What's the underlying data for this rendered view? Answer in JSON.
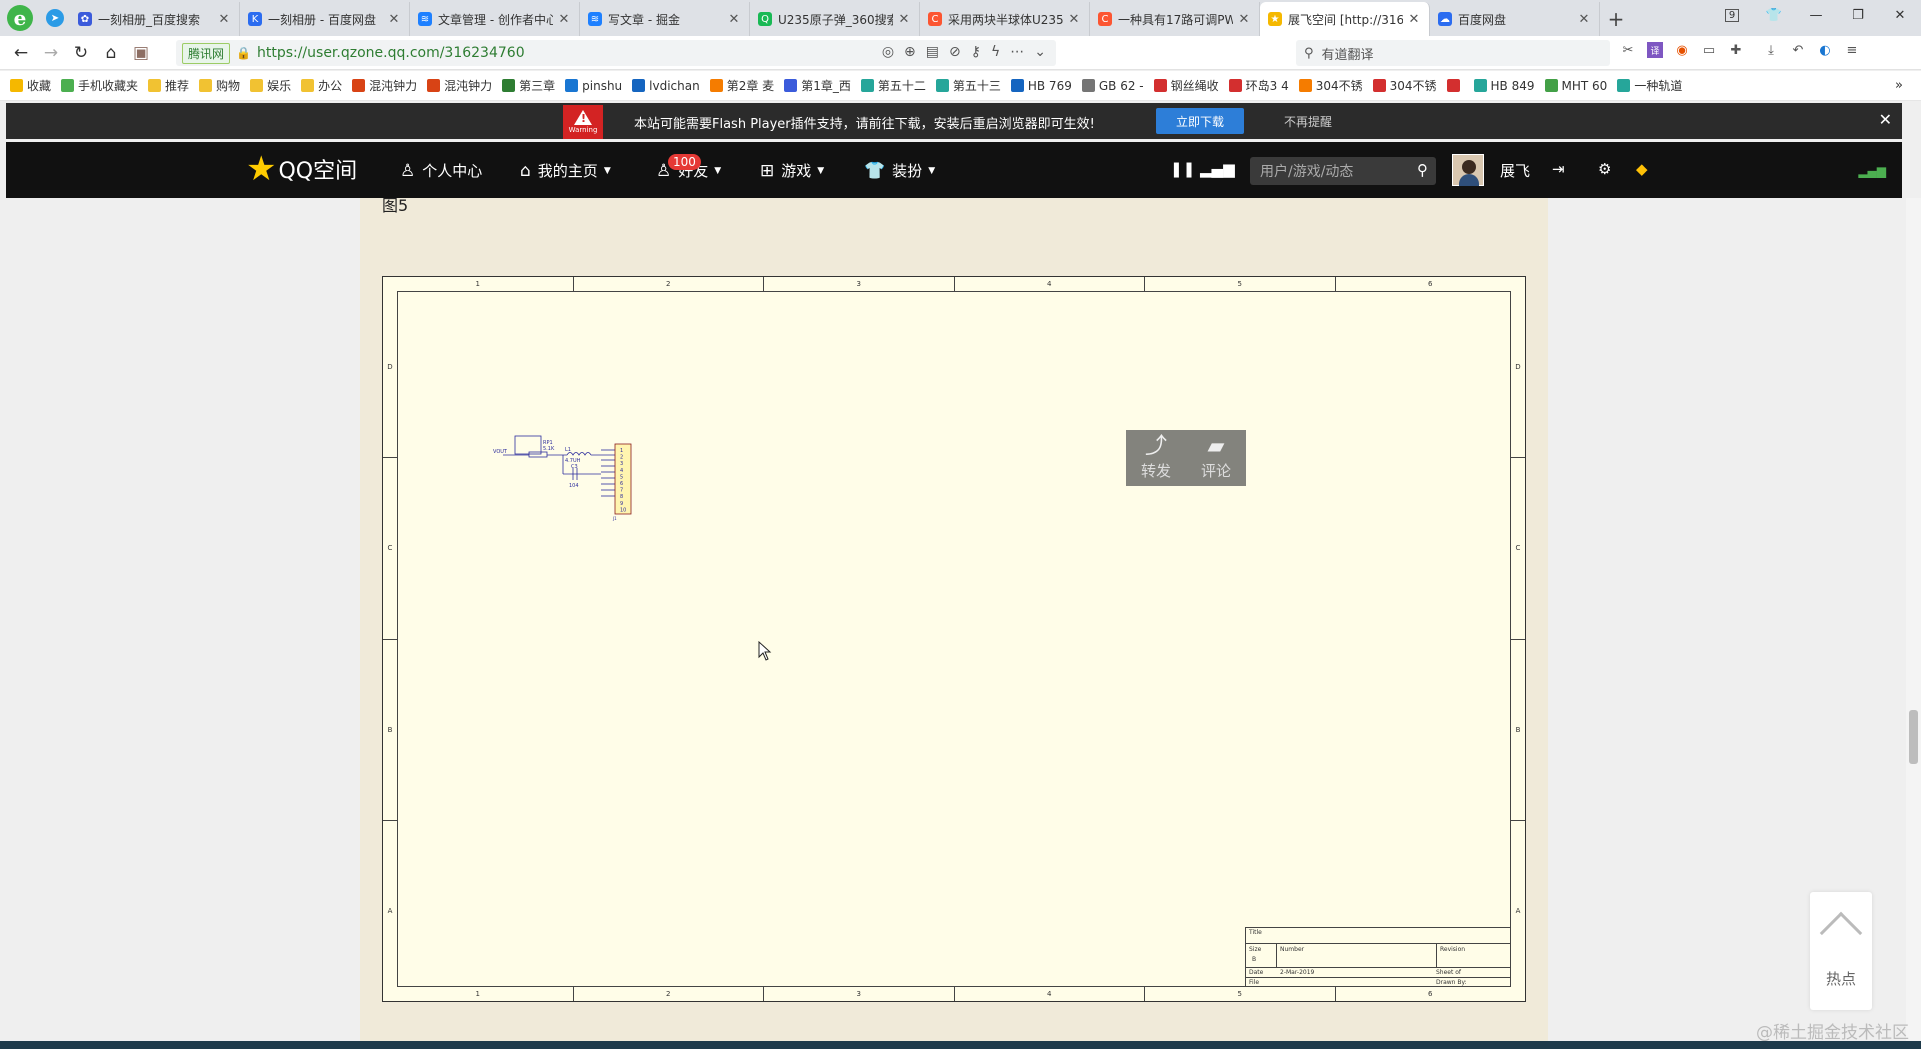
{
  "tabs": [
    {
      "title": "一刻相册_百度搜索",
      "fav_color": "#3b5bdb",
      "fav_glyph": "✿",
      "active": false
    },
    {
      "title": "一刻相册 - 百度网盘",
      "fav_color": "#2b6cf0",
      "fav_glyph": "K",
      "active": false
    },
    {
      "title": "文章管理 - 创作者中心",
      "fav_color": "#1e80ff",
      "fav_glyph": "≋",
      "active": false
    },
    {
      "title": "写文章 - 掘金",
      "fav_color": "#1e80ff",
      "fav_glyph": "≋",
      "active": false
    },
    {
      "title": "U235原子弹_360搜索",
      "fav_color": "#19b955",
      "fav_glyph": "Q",
      "active": false
    },
    {
      "title": "采用两块半球体U235",
      "fav_color": "#fc5531",
      "fav_glyph": "C",
      "active": false
    },
    {
      "title": "一种具有17路可调PW",
      "fav_color": "#fc5531",
      "fav_glyph": "C",
      "active": false
    },
    {
      "title": "展飞空间 [http://316",
      "fav_color": "#f5b800",
      "fav_glyph": "★",
      "active": true
    },
    {
      "title": "百度网盘",
      "fav_color": "#2b6cf0",
      "fav_glyph": "☁",
      "active": false
    }
  ],
  "tab_counter": "9",
  "address": {
    "secure_label": "腾讯网",
    "url": "https://user.qzone.qq.com/316234760"
  },
  "search": {
    "placeholder": "有道翻译"
  },
  "bookmarks": [
    {
      "label": "收藏",
      "color": "#f5b800"
    },
    {
      "label": "手机收藏夹",
      "color": "#4caf50"
    },
    {
      "label": "推荐",
      "color": "#f1c232"
    },
    {
      "label": "购物",
      "color": "#f1c232"
    },
    {
      "label": "娱乐",
      "color": "#f1c232"
    },
    {
      "label": "办公",
      "color": "#f1c232"
    },
    {
      "label": "混沌钟力",
      "color": "#d84315"
    },
    {
      "label": "混沌钟力",
      "color": "#d84315"
    },
    {
      "label": "第三章",
      "color": "#2e7d32"
    },
    {
      "label": "pinshu",
      "color": "#1976d2"
    },
    {
      "label": "lvdichan",
      "color": "#1565c0"
    },
    {
      "label": "第2章 麦",
      "color": "#f57c00"
    },
    {
      "label": "第1章_西",
      "color": "#3b5bdb"
    },
    {
      "label": "第五十二",
      "color": "#26a69a"
    },
    {
      "label": "第五十三",
      "color": "#26a69a"
    },
    {
      "label": "HB 769",
      "color": "#1565c0"
    },
    {
      "label": "GB 62 -",
      "color": "#757575"
    },
    {
      "label": "钢丝绳收",
      "color": "#d32f2f"
    },
    {
      "label": "环岛3 4",
      "color": "#d32f2f"
    },
    {
      "label": "304不锈",
      "color": "#f57c00"
    },
    {
      "label": "304不锈",
      "color": "#d32f2f"
    },
    {
      "label": "",
      "color": "#d32f2f"
    },
    {
      "label": "HB 849",
      "color": "#26a69a"
    },
    {
      "label": "MHT 60",
      "color": "#43a047"
    },
    {
      "label": "一种轨道",
      "color": "#26a69a"
    }
  ],
  "flash": {
    "warning_label": "Warning",
    "message": "本站可能需要Flash Player插件支持，请前往下载，安装后重启浏览器即可生效!",
    "download_label": "立即下载",
    "dismiss_label": "不再提醒"
  },
  "qzone": {
    "logo_text": "QQ空间",
    "nav": [
      {
        "label": "个人中心",
        "icon": "user-icon",
        "caret": false
      },
      {
        "label": "我的主页",
        "icon": "home-icon",
        "caret": true
      },
      {
        "label": "好友",
        "icon": "friends-icon",
        "caret": true
      },
      {
        "label": "游戏",
        "icon": "grid-icon",
        "caret": true
      },
      {
        "label": "装扮",
        "icon": "shirt-icon",
        "caret": true
      }
    ],
    "friends_badge": "100",
    "search_placeholder": "用户/游戏/动态",
    "username": "展飞"
  },
  "content": {
    "figure_caption": "图5",
    "schematic": {
      "col_labels": [
        "1",
        "2",
        "3",
        "4",
        "5",
        "6"
      ],
      "row_labels": [
        "D",
        "C",
        "B",
        "A"
      ],
      "title_block": {
        "title": "Title",
        "size_label": "Size",
        "size_value": "B",
        "number_label": "Number",
        "revision_label": "Revision",
        "date_label": "Date",
        "date_value": "2-Mar-2019",
        "sheet_label": "Sheet  of",
        "file_label": "File",
        "drawn_label": "Drawn By:"
      },
      "circuit_labels": {
        "vout": "VOUT",
        "rp": "RP1",
        "rp_val": "5.1K",
        "l": "L1",
        "l_val": "4.7UH",
        "c": "C3",
        "c_val": "104",
        "connector_pins": [
          "1",
          "2",
          "3",
          "4",
          "5",
          "6",
          "7",
          "8",
          "9",
          "10"
        ]
      }
    },
    "share_label": "转发",
    "comment_label": "评论"
  },
  "hot_label": "热点",
  "watermark": "@稀土掘金技术社区"
}
